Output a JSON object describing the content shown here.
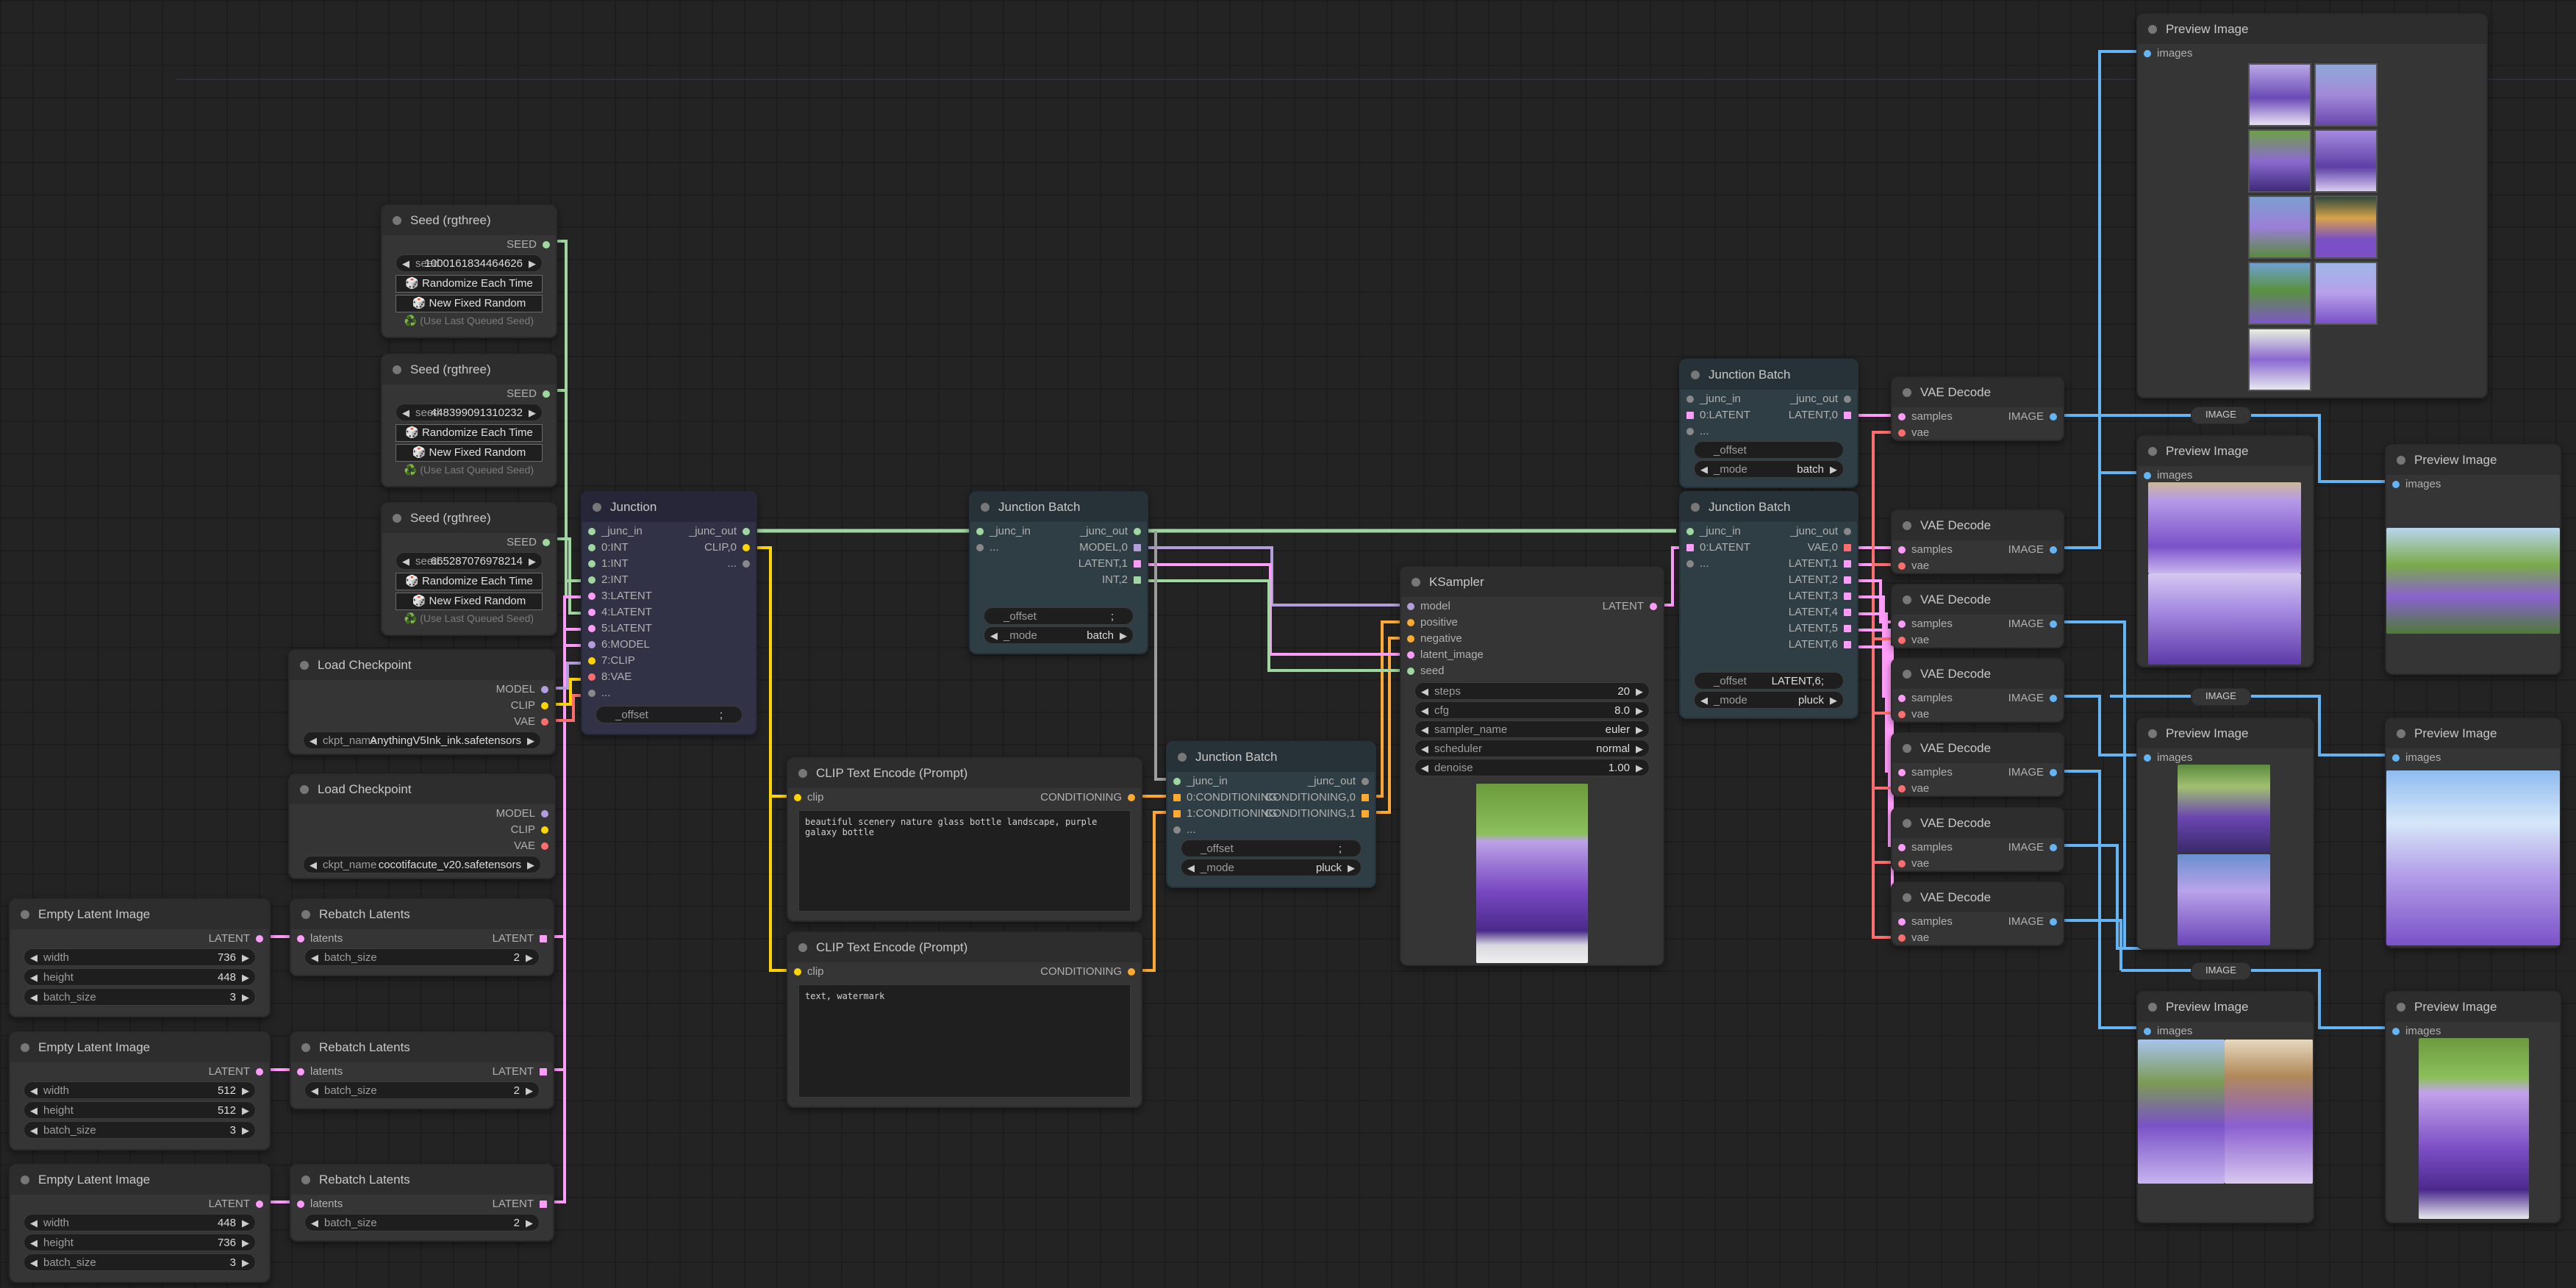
{
  "colors": {
    "model": "#b39ddb",
    "clip": "#ffd500",
    "vae": "#ff6e6e",
    "latent": "#ff9cf9",
    "image": "#64b5f6",
    "conditioning": "#ffa931",
    "int": "#a0d6a0",
    "seed": "#a0d6a0",
    "any": "#9e9e9e"
  },
  "seed_nodes": [
    {
      "title": "Seed (rgthree)",
      "out": "SEED",
      "seed_label": "seed",
      "seed_value": "1000161834464626",
      "btn_random": "🎲 Randomize Each Time",
      "btn_fixed": "🎲 New Fixed Random",
      "last": "♻️ (Use Last Queued Seed)"
    },
    {
      "title": "Seed (rgthree)",
      "out": "SEED",
      "seed_label": "seed",
      "seed_value": "448399091310232",
      "btn_random": "🎲 Randomize Each Time",
      "btn_fixed": "🎲 New Fixed Random",
      "last": "♻️ (Use Last Queued Seed)"
    },
    {
      "title": "Seed (rgthree)",
      "out": "SEED",
      "seed_label": "seed",
      "seed_value": "665287076978214",
      "btn_random": "🎲 Randomize Each Time",
      "btn_fixed": "🎲 New Fixed Random",
      "last": "♻️ (Use Last Queued Seed)"
    }
  ],
  "load_checkpoints": [
    {
      "title": "Load Checkpoint",
      "out_model": "MODEL",
      "out_clip": "CLIP",
      "out_vae": "VAE",
      "ckpt_label": "ckpt_name",
      "ckpt_value": "AnythingV5Ink_ink.safetensors"
    },
    {
      "title": "Load Checkpoint",
      "out_model": "MODEL",
      "out_clip": "CLIP",
      "out_vae": "VAE",
      "ckpt_label": "ckpt_name",
      "ckpt_value": "cocotifacute_v20.safetensors"
    }
  ],
  "empty_latents": [
    {
      "title": "Empty Latent Image",
      "out": "LATENT",
      "width_label": "width",
      "width": "736",
      "height_label": "height",
      "height": "448",
      "batch_label": "batch_size",
      "batch": "3"
    },
    {
      "title": "Empty Latent Image",
      "out": "LATENT",
      "width_label": "width",
      "width": "512",
      "height_label": "height",
      "height": "512",
      "batch_label": "batch_size",
      "batch": "3"
    },
    {
      "title": "Empty Latent Image",
      "out": "LATENT",
      "width_label": "width",
      "width": "448",
      "height_label": "height",
      "height": "736",
      "batch_label": "batch_size",
      "batch": "3"
    }
  ],
  "rebatch": [
    {
      "title": "Rebatch Latents",
      "in": "latents",
      "out": "LATENT",
      "batch_label": "batch_size",
      "batch": "2"
    },
    {
      "title": "Rebatch Latents",
      "in": "latents",
      "out": "LATENT",
      "batch_label": "batch_size",
      "batch": "2"
    },
    {
      "title": "Rebatch Latents",
      "in": "latents",
      "out": "LATENT",
      "batch_label": "batch_size",
      "batch": "2"
    }
  ],
  "junction": {
    "title": "Junction",
    "in": "_junc_in",
    "out": "_junc_out",
    "inputs": [
      "0:INT",
      "1:INT",
      "2:INT",
      "3:LATENT",
      "4:LATENT",
      "5:LATENT",
      "6:MODEL",
      "7:CLIP",
      "8:VAE",
      "..."
    ],
    "outputs": [
      "CLIP,0",
      "..."
    ],
    "offset_label": "_offset",
    "offset_value": ";"
  },
  "junction_batch_1": {
    "title": "Junction Batch",
    "in": "_junc_in",
    "out": "_junc_out",
    "in_more": "...",
    "outputs": [
      "MODEL,0",
      "LATENT,1",
      "INT,2"
    ],
    "offset_label": "_offset",
    "offset_value": ";",
    "mode_label": "_mode",
    "mode_value": "batch"
  },
  "junction_batch_2": {
    "title": "Junction Batch",
    "in": "_junc_in",
    "out": "_junc_out",
    "inputs": [
      "0:CONDITIONING",
      "1:CONDITIONING"
    ],
    "in_more": "...",
    "outputs": [
      "CONDITIONING,0",
      "CONDITIONING,1"
    ],
    "offset_label": "_offset",
    "offset_value": ";",
    "mode_label": "_mode",
    "mode_value": "pluck"
  },
  "junction_batch_3": {
    "title": "Junction Batch",
    "in": "_junc_in",
    "out": "_junc_out",
    "inputs": [
      "0:LATENT"
    ],
    "in_more": "...",
    "outputs": [
      "LATENT,0"
    ],
    "offset_label": "_offset",
    "offset_value": "",
    "mode_label": "_mode",
    "mode_value": "batch"
  },
  "junction_batch_4": {
    "title": "Junction Batch",
    "in": "_junc_in",
    "out": "_junc_out",
    "inputs": [
      "0:LATENT"
    ],
    "in_more": "...",
    "outputs": [
      "VAE,0",
      "LATENT,1",
      "LATENT,2",
      "LATENT,3",
      "LATENT,4",
      "LATENT,5",
      "LATENT,6"
    ],
    "offset_label": "_offset",
    "offset_value": "LATENT,6;",
    "mode_label": "_mode",
    "mode_value": "pluck"
  },
  "clip_encode": [
    {
      "title": "CLIP Text Encode (Prompt)",
      "in": "clip",
      "out": "CONDITIONING",
      "text": "beautiful scenery nature glass bottle landscape, purple galaxy bottle"
    },
    {
      "title": "CLIP Text Encode (Prompt)",
      "in": "clip",
      "out": "CONDITIONING",
      "text": "text, watermark"
    }
  ],
  "ksampler": {
    "title": "KSampler",
    "inputs": [
      "model",
      "positive",
      "negative",
      "latent_image",
      "seed"
    ],
    "out": "LATENT",
    "widgets": [
      {
        "label": "steps",
        "value": "20"
      },
      {
        "label": "cfg",
        "value": "8.0"
      },
      {
        "label": "sampler_name",
        "value": "euler"
      },
      {
        "label": "scheduler",
        "value": "normal"
      },
      {
        "label": "denoise",
        "value": "1.00"
      }
    ]
  },
  "vae_decode": [
    {
      "title": "VAE Decode",
      "in1": "samples",
      "in2": "vae",
      "out": "IMAGE"
    },
    {
      "title": "VAE Decode",
      "in1": "samples",
      "in2": "vae",
      "out": "IMAGE"
    },
    {
      "title": "VAE Decode",
      "in1": "samples",
      "in2": "vae",
      "out": "IMAGE"
    },
    {
      "title": "VAE Decode",
      "in1": "samples",
      "in2": "vae",
      "out": "IMAGE"
    },
    {
      "title": "VAE Decode",
      "in1": "samples",
      "in2": "vae",
      "out": "IMAGE"
    },
    {
      "title": "VAE Decode",
      "in1": "samples",
      "in2": "vae",
      "out": "IMAGE"
    },
    {
      "title": "VAE Decode",
      "in1": "samples",
      "in2": "vae",
      "out": "IMAGE"
    }
  ],
  "preview": [
    {
      "title": "Preview Image",
      "in": "images"
    },
    {
      "title": "Preview Image",
      "in": "images"
    },
    {
      "title": "Preview Image",
      "in": "images"
    },
    {
      "title": "Preview Image",
      "in": "images"
    },
    {
      "title": "Preview Image",
      "in": "images"
    },
    {
      "title": "Preview Image",
      "in": "images"
    },
    {
      "title": "Preview Image",
      "in": "images"
    }
  ],
  "reroute_label": "IMAGE"
}
